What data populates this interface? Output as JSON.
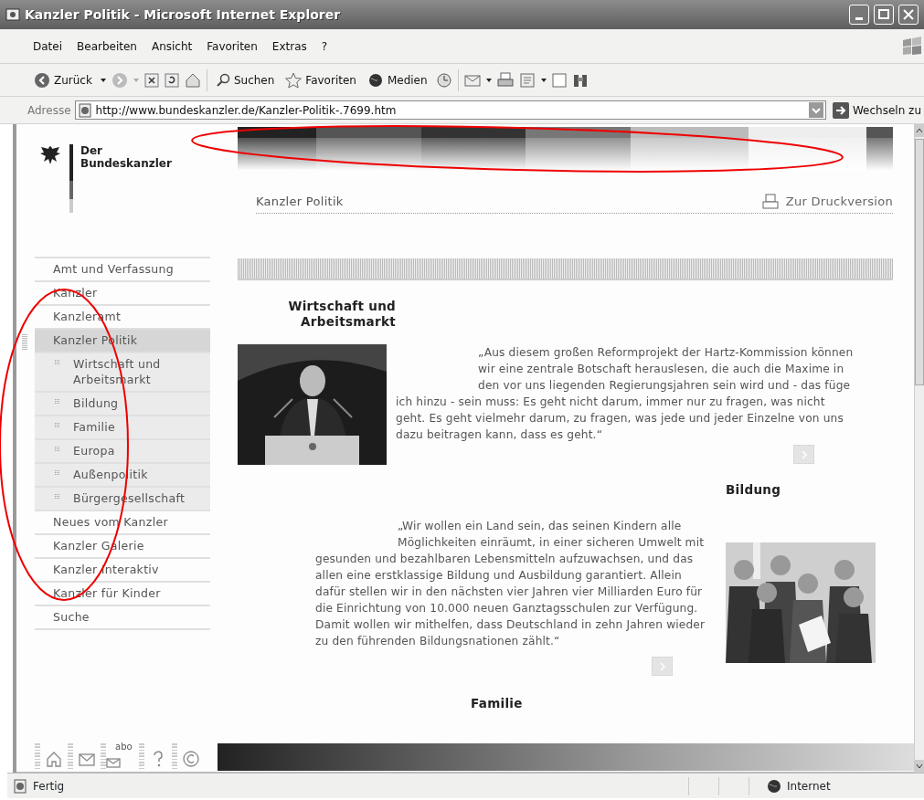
{
  "window": {
    "title": "Kanzler Politik - Microsoft Internet Explorer"
  },
  "menu": [
    "Datei",
    "Bearbeiten",
    "Ansicht",
    "Favoriten",
    "Extras",
    "?"
  ],
  "toolbar": {
    "back_label": "Zurück",
    "search_label": "Suchen",
    "favorites_label": "Favoriten",
    "media_label": "Medien"
  },
  "address_bar": {
    "label": "Adresse",
    "url": "http://www.bundeskanzler.de/Kanzler-Politik-.7699.htm",
    "go_label": "Wechseln zu"
  },
  "logo": {
    "lines": [
      "Der",
      "Bundeskanzler"
    ]
  },
  "nav": [
    {
      "label": "Amt und Verfassung",
      "selected": false
    },
    {
      "label": "Kanzler",
      "selected": false
    },
    {
      "label": "Kanzleramt",
      "selected": false
    },
    {
      "label": "Kanzler Politik",
      "selected": true,
      "children": [
        {
          "label": "Wirtschaft und Arbeitsmarkt"
        },
        {
          "label": "Bildung"
        },
        {
          "label": "Familie"
        },
        {
          "label": "Europa"
        },
        {
          "label": "Außenpolitik"
        },
        {
          "label": "Bürgergesellschaft"
        }
      ]
    },
    {
      "label": "Neues vom Kanzler",
      "selected": false
    },
    {
      "label": "Kanzler Galerie",
      "selected": false
    },
    {
      "label": "Kanzler Interaktiv",
      "selected": false
    },
    {
      "label": "Kanzler für Kinder",
      "selected": false
    },
    {
      "label": "Suche",
      "selected": false
    }
  ],
  "breadcrumb": "Kanzler Politik",
  "print_link": "Zur Druckversion",
  "sections": [
    {
      "kind": "image_left",
      "heading": "Wirtschaft und Arbeitsmarkt",
      "quote": "„Aus diesem großen Reformprojekt der Hartz-Kommission können wir eine zentrale Botschaft herauslesen, die auch die Maxime in den vor uns liegenden Regierungsjahren sein wird und - das füge ich hinzu - sein muss: Es geht nicht darum, immer nur zu fragen, was nicht geht. Es geht vielmehr darum, zu fragen, was jede und jeder Einzelne von uns dazu beitragen kann, dass es geht.“"
    },
    {
      "kind": "image_right",
      "heading": "Bildung",
      "quote": "„Wir wollen ein Land sein, das seinen Kindern alle Möglichkeiten einräumt, in einer sicheren Umwelt mit gesunden und bezahlbaren Lebensmitteln aufzuwachsen, und das allen eine erstklassige Bildung und Ausbildung garantiert. Allein dafür stellen wir in den nächsten vier Jahren vier Milliarden Euro für die Einrichtung von 10.000 neuen Ganztagsschulen zur Verfügung. Damit wollen wir mithelfen, dass Deutschland in zehn Jahren wieder zu den führenden Bildungsnationen zählt.“"
    },
    {
      "kind": "heading_only",
      "heading": "Familie"
    }
  ],
  "footer": {
    "abo_text": "abo"
  },
  "status_bar": {
    "text": "Fertig",
    "zone": "Internet"
  }
}
